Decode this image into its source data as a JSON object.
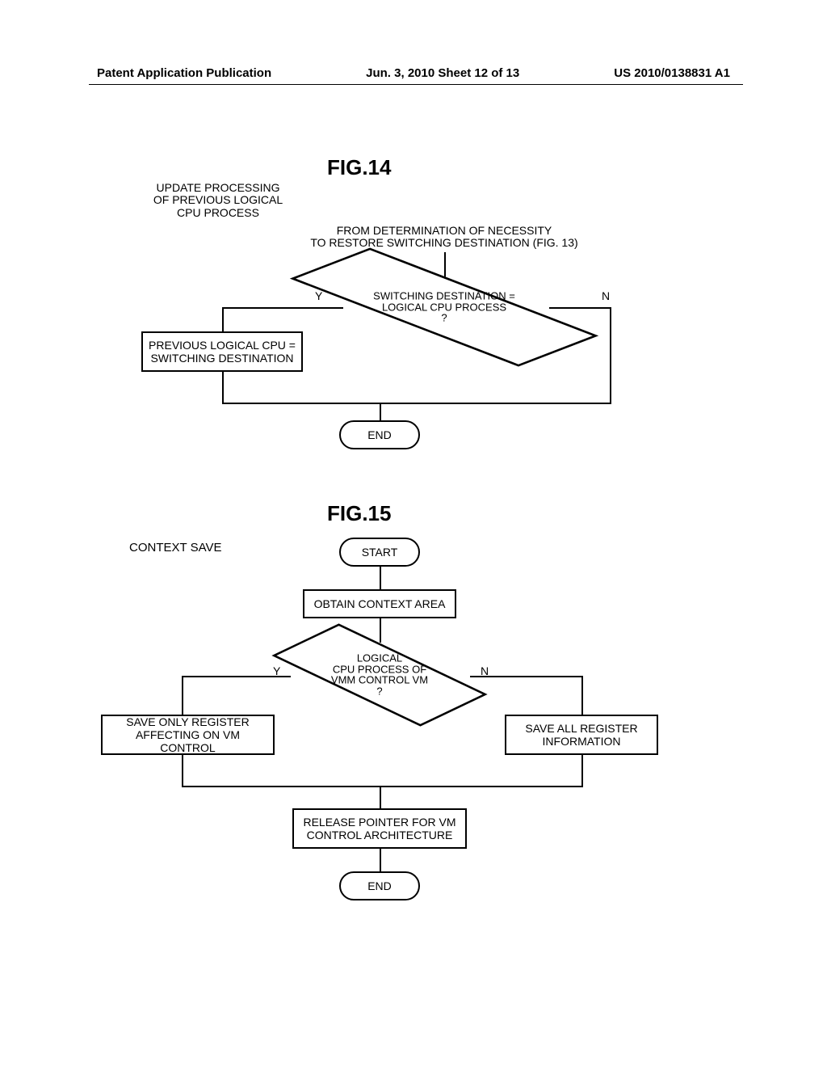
{
  "header": {
    "left": "Patent Application Publication",
    "center": "Jun. 3, 2010  Sheet 12 of 13",
    "right": "US 2010/0138831 A1"
  },
  "fig14": {
    "title": "FIG.14",
    "proc_title_l1": "UPDATE PROCESSING",
    "proc_title_l2": "OF PREVIOUS LOGICAL",
    "proc_title_l3": "CPU PROCESS",
    "from_l1": "FROM DETERMINATION OF NECESSITY",
    "from_l2": "TO RESTORE SWITCHING DESTINATION (FIG. 13)",
    "decision_l1": "SWITCHING DESTINATION =",
    "decision_l2": "LOGICAL CPU PROCESS",
    "decision_l3": "?",
    "y": "Y",
    "n": "N",
    "yes_box_l1": "PREVIOUS LOGICAL CPU =",
    "yes_box_l2": "SWITCHING DESTINATION",
    "end": "END"
  },
  "fig15": {
    "title": "FIG.15",
    "section": "CONTEXT SAVE",
    "start": "START",
    "obtain": "OBTAIN CONTEXT AREA",
    "decision_l1": "LOGICAL",
    "decision_l2": "CPU PROCESS OF",
    "decision_l3": "VMM CONTROL VM",
    "decision_l4": "?",
    "y": "Y",
    "n": "N",
    "yes_box_l1": "SAVE ONLY REGISTER",
    "yes_box_l2": "AFFECTING ON VM CONTROL",
    "no_box_l1": "SAVE ALL REGISTER",
    "no_box_l2": "INFORMATION",
    "release_l1": "RELEASE POINTER FOR VM",
    "release_l2": "CONTROL ARCHITECTURE",
    "end": "END"
  },
  "chart_data": [
    {
      "type": "flowchart",
      "id": "FIG.14",
      "title": "UPDATE PROCESSING OF PREVIOUS LOGICAL CPU PROCESS",
      "nodes": [
        {
          "id": "in",
          "kind": "entry",
          "text": "FROM DETERMINATION OF NECESSITY TO RESTORE SWITCHING DESTINATION (FIG. 13)"
        },
        {
          "id": "d1",
          "kind": "decision",
          "text": "SWITCHING DESTINATION = LOGICAL CPU PROCESS ?"
        },
        {
          "id": "p1",
          "kind": "process",
          "text": "PREVIOUS LOGICAL CPU = SWITCHING DESTINATION"
        },
        {
          "id": "end",
          "kind": "terminator",
          "text": "END"
        }
      ],
      "edges": [
        {
          "from": "in",
          "to": "d1"
        },
        {
          "from": "d1",
          "to": "p1",
          "label": "Y"
        },
        {
          "from": "d1",
          "to": "end",
          "label": "N"
        },
        {
          "from": "p1",
          "to": "end"
        }
      ]
    },
    {
      "type": "flowchart",
      "id": "FIG.15",
      "title": "CONTEXT SAVE",
      "nodes": [
        {
          "id": "st",
          "kind": "terminator",
          "text": "START"
        },
        {
          "id": "p1",
          "kind": "process",
          "text": "OBTAIN CONTEXT AREA"
        },
        {
          "id": "d1",
          "kind": "decision",
          "text": "LOGICAL CPU PROCESS OF VMM CONTROL VM ?"
        },
        {
          "id": "py",
          "kind": "process",
          "text": "SAVE ONLY REGISTER AFFECTING ON VM CONTROL"
        },
        {
          "id": "pn",
          "kind": "process",
          "text": "SAVE ALL REGISTER INFORMATION"
        },
        {
          "id": "p3",
          "kind": "process",
          "text": "RELEASE POINTER FOR VM CONTROL ARCHITECTURE"
        },
        {
          "id": "end",
          "kind": "terminator",
          "text": "END"
        }
      ],
      "edges": [
        {
          "from": "st",
          "to": "p1"
        },
        {
          "from": "p1",
          "to": "d1"
        },
        {
          "from": "d1",
          "to": "py",
          "label": "Y"
        },
        {
          "from": "d1",
          "to": "pn",
          "label": "N"
        },
        {
          "from": "py",
          "to": "p3"
        },
        {
          "from": "pn",
          "to": "p3"
        },
        {
          "from": "p3",
          "to": "end"
        }
      ]
    }
  ]
}
